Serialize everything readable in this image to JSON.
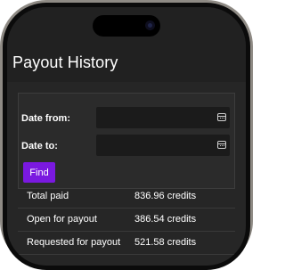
{
  "page": {
    "title": "Payout History"
  },
  "filter": {
    "date_from_label": "Date from:",
    "date_from_value": "",
    "date_to_label": "Date to:",
    "date_to_value": "",
    "find_label": "Find",
    "date_icon": "calendar-icon"
  },
  "summary": [
    {
      "label": "Total paid",
      "value": "836.96 credits"
    },
    {
      "label": "Open for payout",
      "value": "386.54 credits"
    },
    {
      "label": "Requested for payout",
      "value": "521.58 credits"
    }
  ],
  "colors": {
    "accent": "#7a19e0",
    "background": "#262626",
    "header": "#212121",
    "input": "#1b1b1b"
  }
}
